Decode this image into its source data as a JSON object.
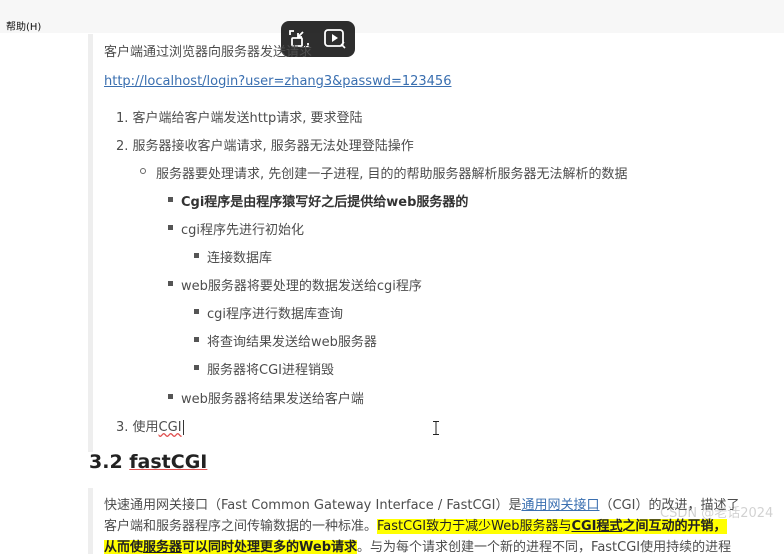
{
  "menu": {
    "help": "帮助(H)"
  },
  "content": {
    "intro": "客户端通过浏览器向服务器发送请求",
    "url": "http://localhost/login?user=zhang3&passwd=123456",
    "step1": "1. 客户端给客户端发送http请求, 要求登陆",
    "step2": "2. 服务器接收客户端请求, 服务器无法处理登陆操作",
    "sub1": "服务器要处理请求, 先创建一子进程, 目的的帮助服务器解析服务器无法解析的数据",
    "cgi_bold": "Cgi程序是由程序猿写好之后提供给web服务器的",
    "cgi_init": "cgi程序先进行初始化",
    "connect_db": "连接数据库",
    "send_data": "web服务器将要处理的数据发送给cgi程序",
    "query_db": "cgi程序进行数据库查询",
    "send_result": "将查询结果发送给web服务器",
    "destroy": "服务器将CGI进程销毁",
    "web_send": "web服务器将结果发送给客户端",
    "step3_prefix": "3. 使用",
    "step3_cgi": "CGI",
    "heading_num": "3.2 ",
    "heading_word": "fastCGI",
    "para_l1_a": "快速通用网关接口（Fast Common Gateway Interface / FastCGI）是",
    "para_l1_link": "通用网关接口",
    "para_l1_b": "（CGI）的改进，描述了",
    "para_l2_a": "客户端和服务器程序之间传输数据的一种标准。",
    "para_l2_hl1": "FastCGI致力于减少Web服务器与",
    "para_l2_link": "CGI程式",
    "para_l2_hl2": "之间互动的开销，",
    "para_l3_hl1": "从而使",
    "para_l3_link": "服务器",
    "para_l3_hl2": "可以同时处理更多的Web请求",
    "para_l3_b": "。与为每个请求创建一个新的进程不同，FastCGI使用持续的进程"
  },
  "watermark": {
    "text": "CSDN @老话2024"
  },
  "colors": {
    "highlight": "#ffff00",
    "link": "#3a6fb0",
    "menubar": "#f7f7f7"
  },
  "icons": [
    "pip-icon",
    "video-play-icon",
    "text-cursor-icon"
  ]
}
